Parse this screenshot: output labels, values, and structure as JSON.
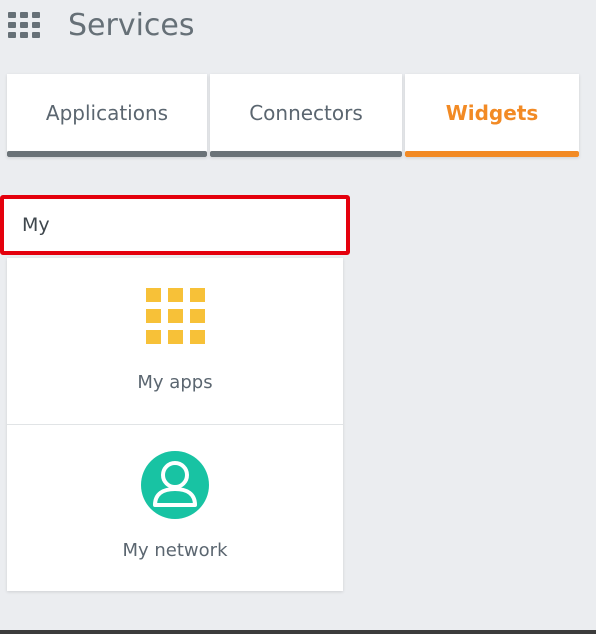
{
  "header": {
    "title": "Services",
    "grid_icon": "app-launcher-grid-icon"
  },
  "tabs": [
    {
      "label": "Applications",
      "active": false
    },
    {
      "label": "Connectors",
      "active": false
    },
    {
      "label": "Widgets",
      "active": true
    }
  ],
  "search": {
    "value": "My",
    "placeholder": ""
  },
  "results": [
    {
      "label": "My apps",
      "icon": "apps-grid-icon",
      "icon_color": "#f7c138"
    },
    {
      "label": "My network",
      "icon": "user-avatar-icon",
      "icon_color": "#18c3a3"
    }
  ],
  "colors": {
    "accent": "#f28a24",
    "highlight_border": "#e4000d",
    "tab_underline": "#6b7378"
  }
}
